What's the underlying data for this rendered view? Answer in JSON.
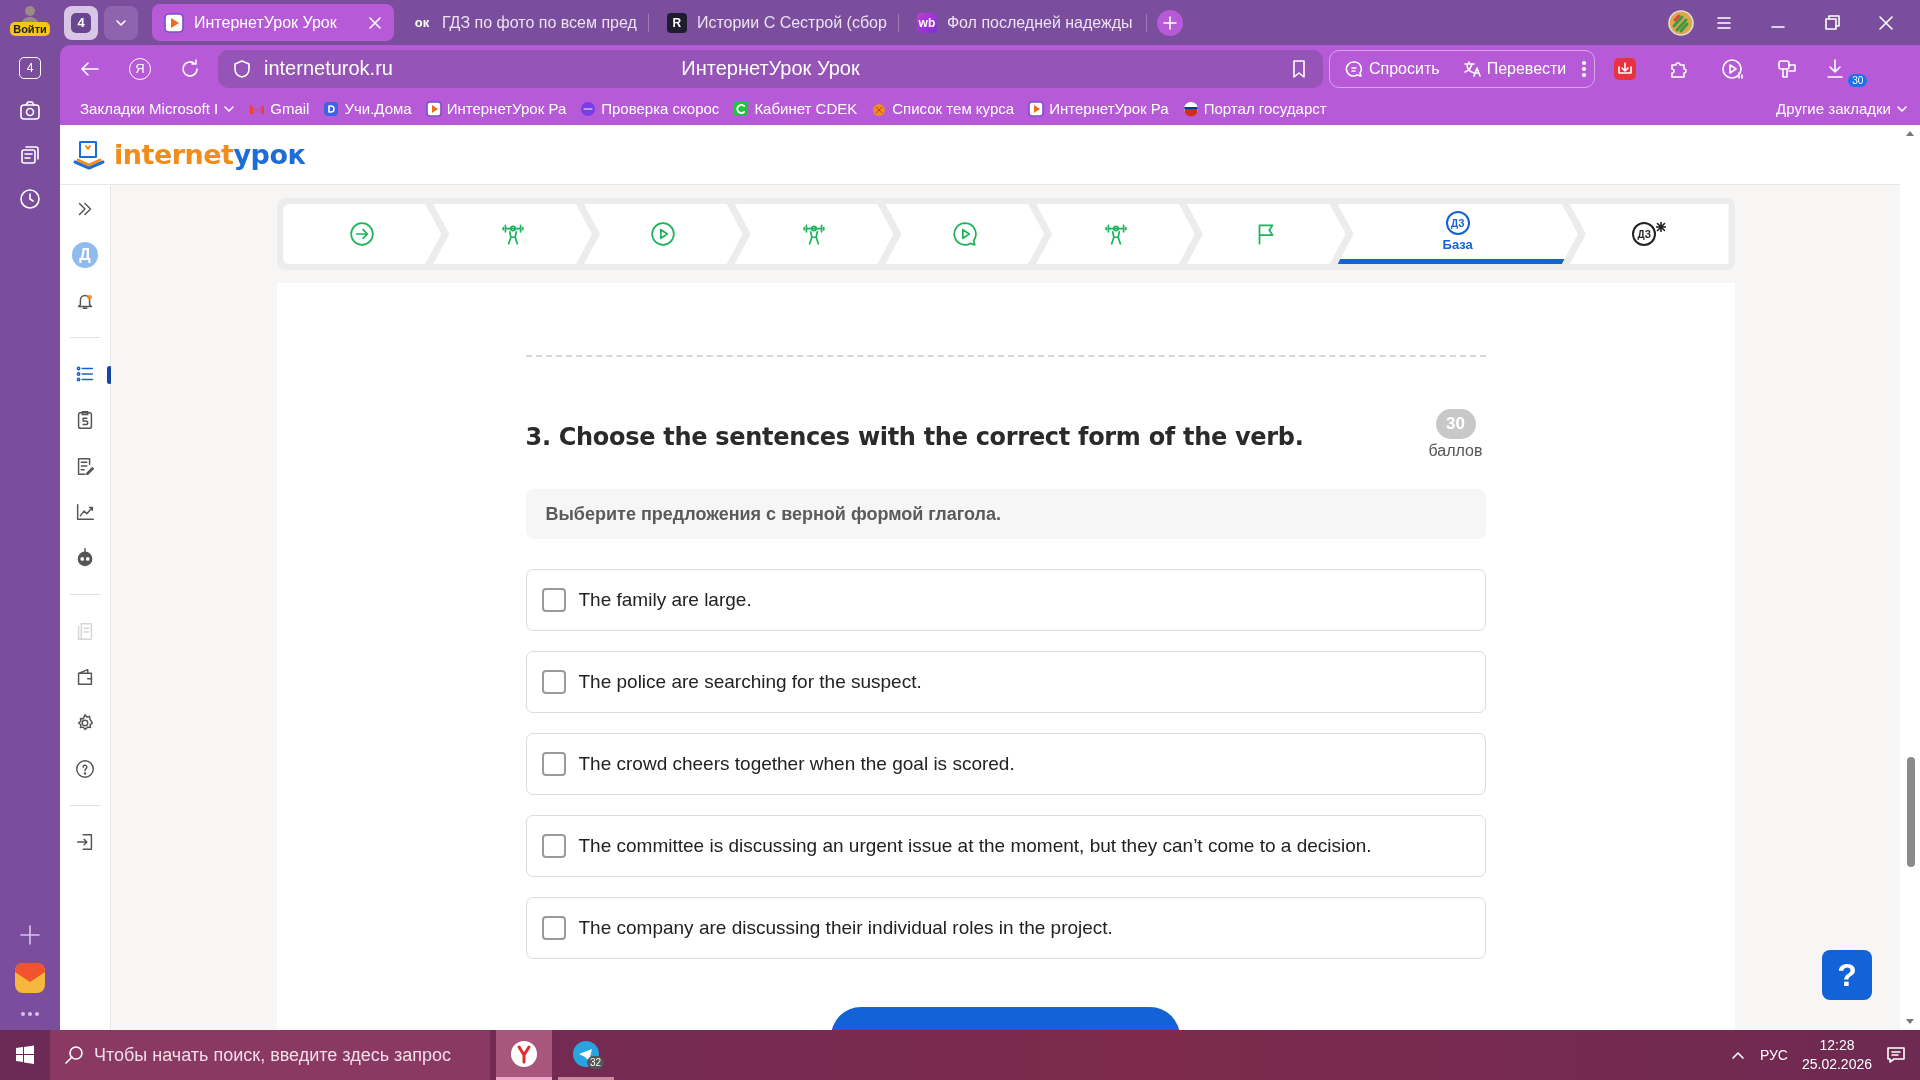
{
  "browser": {
    "profile": {
      "label": "Войти"
    },
    "tab_groups_count": "4",
    "tabs": [
      {
        "title": "ИнтернетУрок Урок",
        "selected": true,
        "favicon": {
          "kind": "play"
        }
      },
      {
        "title": "ГДЗ по фото по всем пред",
        "selected": false,
        "favicon": {
          "kind": "plain",
          "text": "ок"
        }
      },
      {
        "title": "Истории С Сестрой (сбор",
        "selected": false,
        "favicon": {
          "kind": "dark",
          "text": "R"
        }
      },
      {
        "title": "Фол последней надежды",
        "selected": false,
        "favicon": {
          "kind": "violet",
          "text": "wb"
        }
      }
    ],
    "sidebar_count": "4",
    "toolbar": {
      "home_letter": "Я",
      "address": "interneturok.ru",
      "page_title": "ИнтернетУрок Урок",
      "ask": "Спросить",
      "translate": "Перевести",
      "downloads_badge": "30"
    },
    "bookmarks": [
      {
        "label": "Закладки Microsoft I",
        "kind": "folder"
      },
      {
        "label": "Gmail",
        "kind": "gmail"
      },
      {
        "label": "Учи.Дома",
        "kind": "blue"
      },
      {
        "label": "ИнтернетУрок Ра",
        "kind": "play"
      },
      {
        "label": "Проверка скорос",
        "kind": "qms"
      },
      {
        "label": "Кабинет CDEK",
        "kind": "green"
      },
      {
        "label": "Список тем курса",
        "kind": "orange"
      },
      {
        "label": "ИнтернетУрок Ра",
        "kind": "play"
      },
      {
        "label": "Портал государст",
        "kind": "flag"
      }
    ],
    "other_bookmarks": "Другие закладки"
  },
  "site": {
    "logo": {
      "part_1": "internet",
      "part_2": "урок"
    },
    "sidebar": [
      {
        "kind": "expand",
        "selected": false,
        "disabled": false
      },
      {
        "kind": "avatar",
        "text": "Д",
        "selected": false,
        "disabled": false
      },
      {
        "kind": "bell",
        "selected": false,
        "disabled": false
      },
      {
        "kind": "divider"
      },
      {
        "kind": "list",
        "selected": true,
        "disabled": false
      },
      {
        "kind": "clipboard",
        "selected": false,
        "disabled": false
      },
      {
        "kind": "notes",
        "selected": false,
        "disabled": false
      },
      {
        "kind": "chart",
        "selected": false,
        "disabled": false
      },
      {
        "kind": "robot",
        "selected": false,
        "disabled": false
      },
      {
        "kind": "divider"
      },
      {
        "kind": "document",
        "selected": false,
        "disabled": true
      },
      {
        "kind": "wallet",
        "selected": false,
        "disabled": false
      },
      {
        "kind": "gear",
        "selected": false,
        "disabled": false
      },
      {
        "kind": "help",
        "selected": false,
        "disabled": false
      },
      {
        "kind": "divider"
      },
      {
        "kind": "logout",
        "selected": false,
        "disabled": false
      }
    ],
    "steps": [
      {
        "kind": "start",
        "selected": false
      },
      {
        "kind": "exercise",
        "selected": false
      },
      {
        "kind": "video",
        "selected": false
      },
      {
        "kind": "exercise",
        "selected": false
      },
      {
        "kind": "video-chat",
        "selected": false
      },
      {
        "kind": "exercise",
        "selected": false
      },
      {
        "kind": "finish",
        "selected": false
      },
      {
        "kind": "homework",
        "icon_text": "ДЗ",
        "label": "База",
        "selected": true
      },
      {
        "kind": "homework-extra",
        "icon_text": "ДЗ",
        "selected": false
      }
    ],
    "question": {
      "title": "3. Choose the sentences with the correct form of the verb.",
      "points": "30",
      "points_label": "баллов",
      "instruction": "Выберите предложения с верной формой глагола.",
      "options": [
        {
          "text": "The family are large.",
          "checked": false
        },
        {
          "text": "The police are searching for the suspect.",
          "checked": false
        },
        {
          "text": "The crowd cheers together when the goal is scored.",
          "checked": false
        },
        {
          "text": "The committee is discussing an urgent issue at the moment, but they can’t come to a decision.",
          "checked": false
        },
        {
          "text": "The company are discussing their individual roles in the project.",
          "checked": false
        }
      ]
    },
    "help_button": "?"
  },
  "taskbar": {
    "search_placeholder": "Чтобы начать поиск, введите здесь запрос",
    "telegram_badge": "32",
    "language": "РУС",
    "time": "12:28",
    "date": "25.02.2026"
  }
}
